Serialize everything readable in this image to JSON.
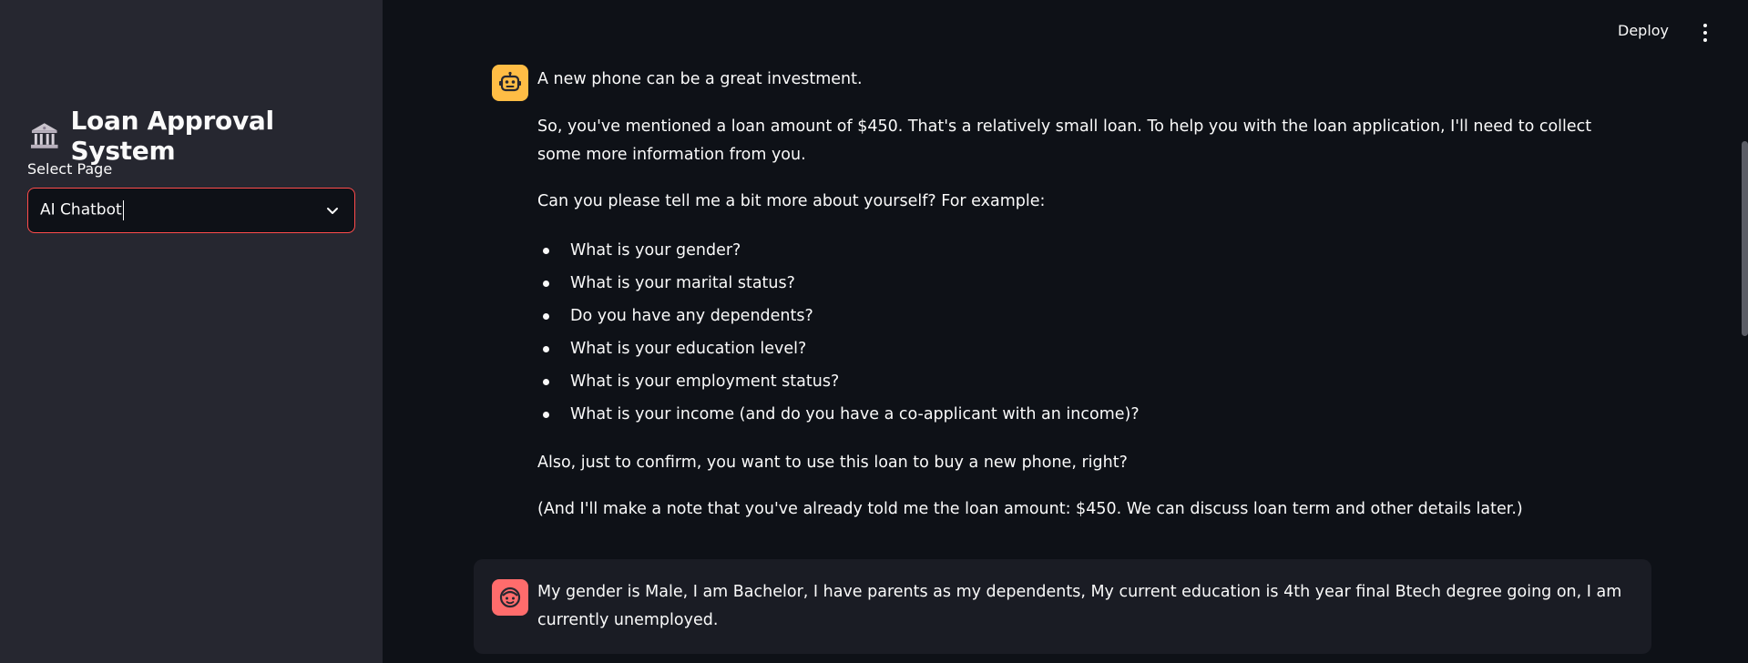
{
  "sidebar": {
    "title": "Loan Approval System",
    "title_icon": "bank-building-icon",
    "select_label": "Select Page",
    "select_value": "AI Chatbot"
  },
  "header": {
    "deploy_label": "Deploy",
    "menu_icon": "kebab-menu-icon"
  },
  "chat": {
    "bot_message": {
      "avatar_icon": "robot-icon",
      "intro": "A new phone can be a great investment.",
      "para1": "So, you've mentioned a loan amount of $450. That's a relatively small loan. To help you with the loan application, I'll need to collect some more information from you.",
      "para2": "Can you please tell me a bit more about yourself? For example:",
      "questions": [
        "What is your gender?",
        "What is your marital status?",
        "Do you have any dependents?",
        "What is your education level?",
        "What is your employment status?",
        "What is your income (and do you have a co-applicant with an income)?"
      ],
      "para3": "Also, just to confirm, you want to use this loan to buy a new phone, right?",
      "para4": "(And I'll make a note that you've already told me the loan amount: $450. We can discuss loan term and other details later.)"
    },
    "user_message": {
      "avatar_icon": "user-face-icon",
      "text": "My gender is Male, I am Bachelor, I have parents as my dependents, My current education is 4th year final Btech degree going on, I am currently unemployed."
    }
  },
  "colors": {
    "background": "#0e1117",
    "sidebar": "#262730",
    "accent": "#ff4b4b",
    "bot_avatar": "#ffbd45",
    "user_avatar": "#ff6c6c"
  }
}
